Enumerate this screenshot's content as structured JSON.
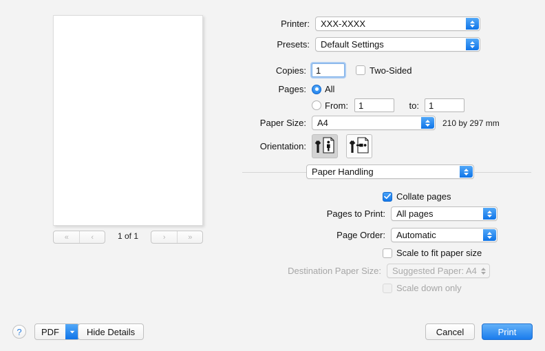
{
  "preview": {
    "page_indicator": "1 of 1",
    "nav": {
      "first_label": "«",
      "prev_label": "‹",
      "next_label": "›",
      "last_label": "»"
    }
  },
  "settings": {
    "printer": {
      "label": "Printer:",
      "value": "XXX-XXXX"
    },
    "presets": {
      "label": "Presets:",
      "value": "Default Settings"
    },
    "copies": {
      "label": "Copies:",
      "value": "1"
    },
    "two_sided": {
      "label": "Two-Sided",
      "checked": false
    },
    "pages": {
      "label": "Pages:",
      "all_label": "All",
      "from_label": "From:",
      "from_value": "1",
      "to_label": "to:",
      "to_value": "1",
      "selected": "All"
    },
    "paper_size": {
      "label": "Paper Size:",
      "value": "A4",
      "dimensions": "210 by 297 mm"
    },
    "orientation": {
      "label": "Orientation:",
      "portrait_name": "portrait",
      "landscape_name": "landscape",
      "selected": "portrait"
    },
    "pane_selector": {
      "value": "Paper Handling"
    },
    "collate": {
      "label": "Collate pages",
      "checked": true
    },
    "pages_to_print": {
      "label": "Pages to Print:",
      "value": "All pages"
    },
    "page_order": {
      "label": "Page Order:",
      "value": "Automatic"
    },
    "scale_to_fit": {
      "label": "Scale to fit paper size",
      "checked": false
    },
    "destination_paper_size": {
      "label": "Destination Paper Size:",
      "value": "Suggested Paper: A4",
      "disabled": true
    },
    "scale_down_only": {
      "label": "Scale down only",
      "checked": false,
      "disabled": true
    }
  },
  "bottom_bar": {
    "help_label": "?",
    "pdf_label": "PDF",
    "hide_details_label": "Hide Details",
    "cancel_label": "Cancel",
    "print_label": "Print"
  },
  "colors": {
    "accent_blue": "#1478ea",
    "window_bg": "#f3f3f3",
    "disabled_text": "#a6a6a6"
  }
}
